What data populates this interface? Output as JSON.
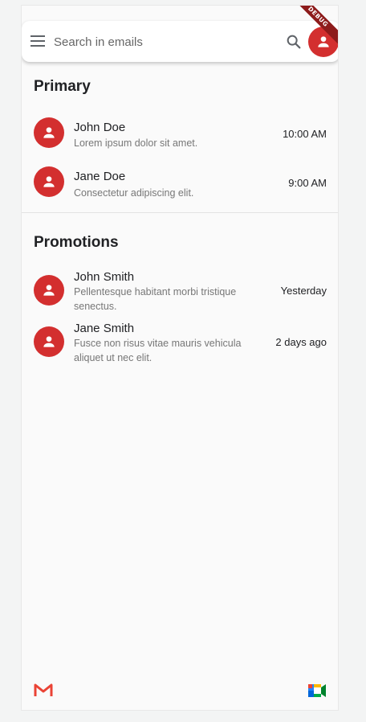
{
  "search": {
    "placeholder": "Search in emails"
  },
  "banner": {
    "label": "DEBUG"
  },
  "icons": {
    "menu": "menu-icon",
    "search": "search-icon",
    "avatar": "person-icon",
    "gmail": "gmail-icon",
    "meet": "google-meet-icon"
  },
  "colors": {
    "accent": "#d32f2f",
    "background": "#fafafa"
  },
  "primary": {
    "title": "Primary",
    "emails": [
      {
        "sender": "John Doe",
        "snippet": "Lorem ipsum dolor sit amet.",
        "time": "10:00 AM"
      },
      {
        "sender": "Jane Doe",
        "snippet": "Consectetur adipiscing elit.",
        "time": "9:00 AM"
      }
    ]
  },
  "promotions": {
    "title": "Promotions",
    "emails": [
      {
        "sender": "John Smith",
        "snippet": "Pellentesque habitant morbi tristique senectus.",
        "time": "Yesterday"
      },
      {
        "sender": "Jane Smith",
        "snippet": "Fusce non risus vitae mauris vehicula aliquet ut nec elit.",
        "time": "2 days ago"
      }
    ]
  }
}
